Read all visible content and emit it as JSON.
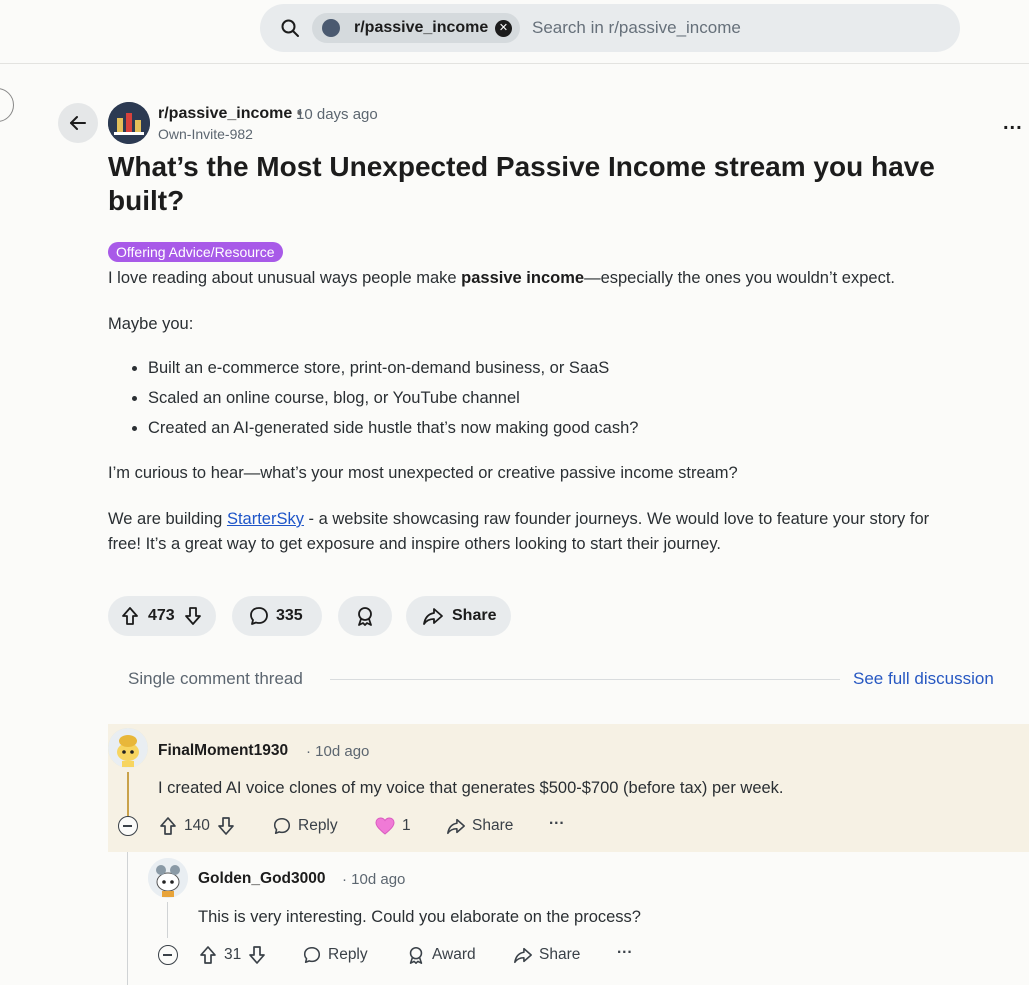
{
  "search": {
    "chip_label": "r/passive_income",
    "placeholder": "Search in r/passive_income"
  },
  "post": {
    "subreddit": "r/passive_income",
    "separator": "•",
    "time_ago": "10 days ago",
    "author": "Own-Invite-982",
    "more": "...",
    "title": "What’s the Most Unexpected Passive Income stream you have built?",
    "flair": "Offering Advice/Resource",
    "intro_before": "I love reading about unusual ways people make ",
    "intro_bold": "passive income",
    "intro_after": "—especially the ones you wouldn’t expect.",
    "maybe": "Maybe you:",
    "bullets": [
      "Built an e-commerce store, print-on-demand business, or SaaS",
      "Scaled an online course, blog, or YouTube channel",
      "Created an AI-generated side hustle that’s now making good cash?"
    ],
    "question": "I’m curious to hear—what’s your most unexpected or creative passive income stream?",
    "promo_before": "We are building ",
    "promo_link": "StarterSky",
    "promo_after": " - a website showcasing raw founder journeys. We would love to feature your story for",
    "promo_line2": "free! It’s a great way to get exposure and inspire others looking to start their journey.",
    "upvotes": "473",
    "comments": "335",
    "share_label": "Share"
  },
  "thread": {
    "label": "Single comment thread",
    "see_full": "See full discussion"
  },
  "comments": [
    {
      "username": "FinalMoment1930",
      "time_ago": "10d ago",
      "text": "I created AI voice clones of my voice that generates $500-$700 (before tax) per week.",
      "votes": "140",
      "reply_label": "Reply",
      "award_count": "1",
      "share_label": "Share",
      "more": "···"
    },
    {
      "username": "Golden_God3000",
      "time_ago": "10d ago",
      "text": "This is very interesting. Could you elaborate on the process?",
      "votes": "31",
      "reply_label": "Reply",
      "award_label": "Award",
      "share_label": "Share",
      "more": "···"
    }
  ],
  "colors": {
    "flair_bg": "#a85ae8",
    "link": "#1e55c8",
    "highlight_bg": "#f6f1e4",
    "thread_line": "#c9a24a"
  }
}
